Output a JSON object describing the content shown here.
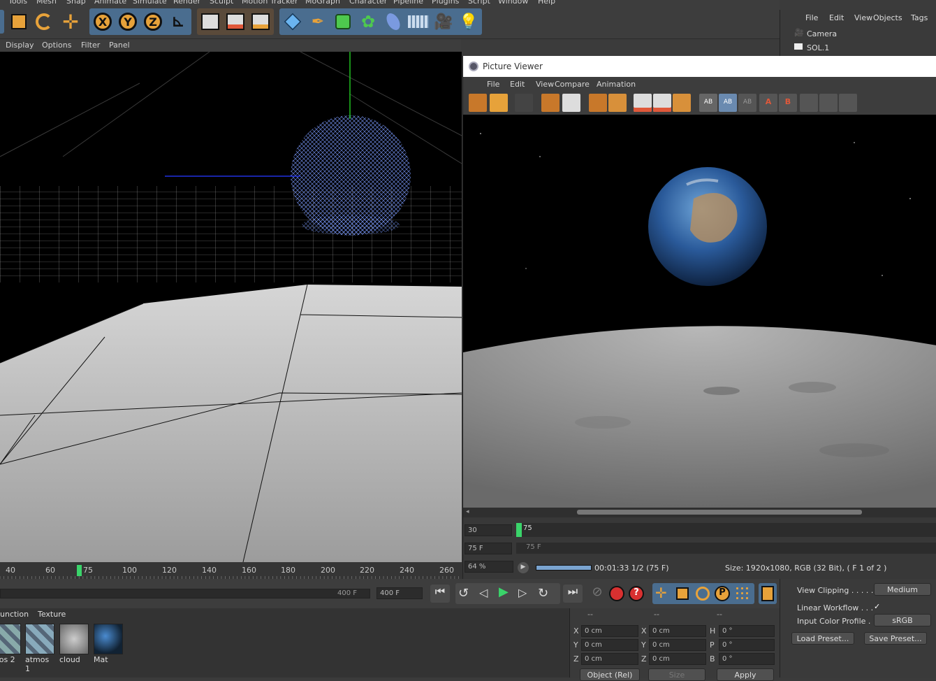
{
  "menubar": {
    "items": [
      "Tools",
      "Mesh",
      "Snap",
      "Animate",
      "Simulate",
      "Render",
      "Sculpt",
      "Motion Tracker",
      "MoGraph",
      "Character",
      "Pipeline",
      "Plugins",
      "Script",
      "Window",
      "Help"
    ]
  },
  "toolbar": {
    "axis_x": "X",
    "axis_y": "Y",
    "axis_z": "Z"
  },
  "viewport_menu": {
    "display": "Display",
    "options": "Options",
    "filter": "Filter",
    "panel": "Panel"
  },
  "timeline": {
    "ticks": [
      "40",
      "60",
      "75",
      "100",
      "120",
      "140",
      "160",
      "180",
      "200",
      "220",
      "240",
      "260"
    ],
    "current_frame": "75"
  },
  "transport": {
    "end_frame_field": "400 F",
    "end_frame_field2": "400 F"
  },
  "material_panel": {
    "tabs": [
      "unction",
      "Texture"
    ],
    "materials": [
      "mos 2",
      "atmos 1",
      "cloud",
      "Mat"
    ]
  },
  "coords": {
    "headers": [
      "--",
      "--",
      "--"
    ],
    "rows": [
      {
        "a": "X",
        "v1": "0 cm",
        "b": "X",
        "v2": "0 cm",
        "c": "H",
        "v3": "0 °"
      },
      {
        "a": "Y",
        "v1": "0 cm",
        "b": "Y",
        "v2": "0 cm",
        "c": "P",
        "v3": "0 °"
      },
      {
        "a": "Z",
        "v1": "0 cm",
        "b": "Z",
        "v2": "0 cm",
        "c": "B",
        "v3": "0 °"
      }
    ],
    "mode": "Object (Rel)",
    "size": "Size",
    "apply": "Apply"
  },
  "object_manager": {
    "menu": [
      "File",
      "Edit",
      "View",
      "Objects",
      "Tags"
    ],
    "objects": [
      "Camera",
      "SOL.1"
    ]
  },
  "attributes": {
    "view_clipping_label": "View Clipping . . . . .",
    "view_clipping_value": "Medium",
    "linear_workflow_label": "Linear Workflow . . .",
    "linear_workflow_check": "✓",
    "input_color_label": "Input Color Profile .",
    "input_color_value": "sRGB",
    "load_preset": "Load Preset...",
    "save_preset": "Save Preset..."
  },
  "picture_viewer": {
    "title": "Picture Viewer",
    "menu": [
      "File",
      "Edit",
      "View",
      "Compare",
      "Animation"
    ],
    "frame_field": "30",
    "frame_marker": "75",
    "frame_field2": "75 F",
    "frame_marker2": "75 F",
    "zoom": "64 %",
    "render_time": "00:01:33 1/2 (75 F)",
    "status": "Size: 1920x1080, RGB (32 Bit),  ( F 1 of 2 )",
    "ab_labels": [
      "AB",
      "AB",
      "AB",
      "A",
      "B"
    ]
  },
  "colors": {
    "accent_orange": "#e7a23a",
    "axis_blue": "#4a6d8f",
    "green_marker": "#3ad46a"
  }
}
